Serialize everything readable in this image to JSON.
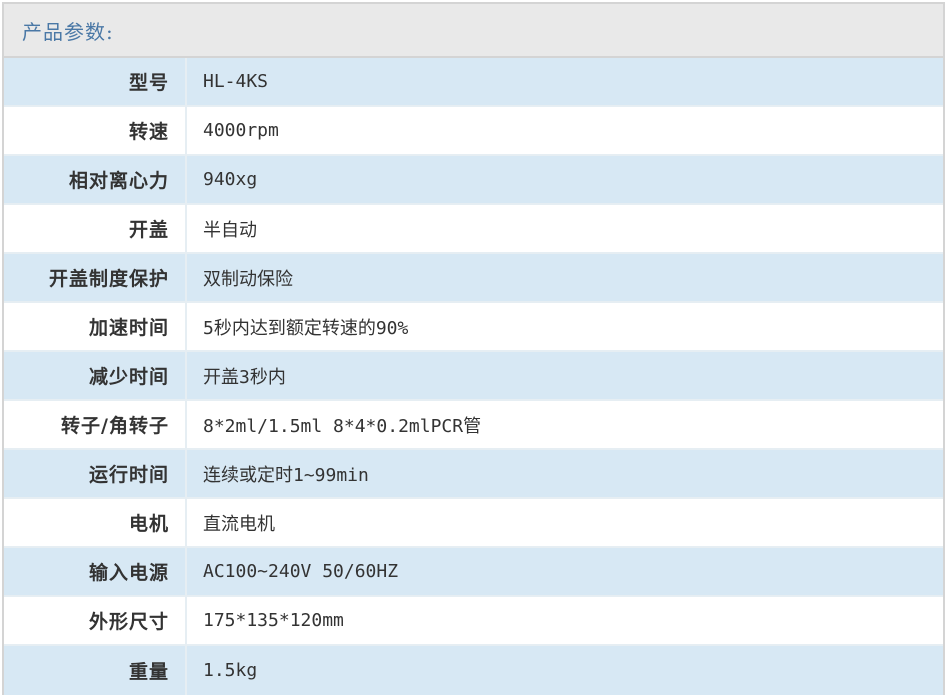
{
  "header": {
    "title": "产品参数:"
  },
  "rows": [
    {
      "label": "型号",
      "value": "HL-4KS"
    },
    {
      "label": "转速",
      "value": "4000rpm"
    },
    {
      "label": "相对离心力",
      "value": "940xg"
    },
    {
      "label": "开盖",
      "value": "半自动"
    },
    {
      "label": "开盖制度保护",
      "value": "双制动保险"
    },
    {
      "label": "加速时间",
      "value": "5秒内达到额定转速的90%"
    },
    {
      "label": "减少时间",
      "value": "开盖3秒内"
    },
    {
      "label": "转子/角转子",
      "value": "8*2ml/1.5ml 8*4*0.2mlPCR管"
    },
    {
      "label": "运行时间",
      "value": "连续或定时1~99min"
    },
    {
      "label": "电机",
      "value": "直流电机"
    },
    {
      "label": "输入电源",
      "value": "AC100~240V 50/60HZ"
    },
    {
      "label": "外形尺寸",
      "value": "175*135*120mm"
    },
    {
      "label": "重量",
      "value": "1.5kg"
    }
  ],
  "colors": {
    "title": "#4a78a6",
    "stripe": "#d7e8f4",
    "header_bg": "#e9e9e9"
  }
}
